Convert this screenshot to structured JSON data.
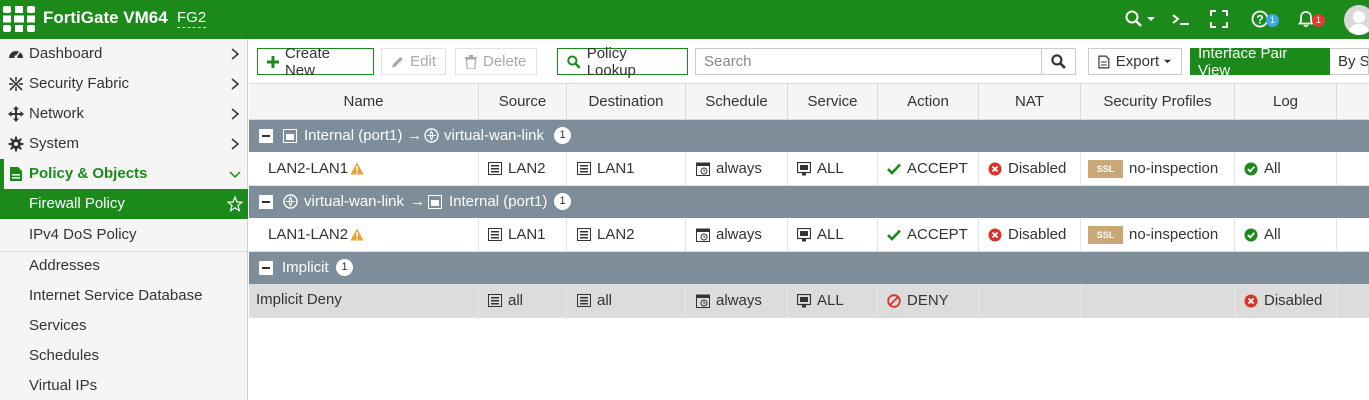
{
  "header": {
    "brand": "FortiGate VM64",
    "hostname": "FG2",
    "help_badge": "1",
    "alerts_badge": "1",
    "colors": {
      "brand": "#1b8a1b",
      "help_badge": "#3fa7e1",
      "alert_badge": "#e03c31"
    }
  },
  "sidebar": {
    "items": [
      {
        "label": "Dashboard",
        "icon": "dashboard-icon"
      },
      {
        "label": "Security Fabric",
        "icon": "security-fabric-icon"
      },
      {
        "label": "Network",
        "icon": "network-icon"
      },
      {
        "label": "System",
        "icon": "gear-icon"
      },
      {
        "label": "Policy & Objects",
        "icon": "policy-icon"
      }
    ],
    "sub_items": [
      {
        "label": "Firewall Policy"
      },
      {
        "label": "IPv4 DoS Policy"
      },
      {
        "label": "Addresses"
      },
      {
        "label": "Internet Service Database"
      },
      {
        "label": "Services"
      },
      {
        "label": "Schedules"
      },
      {
        "label": "Virtual IPs"
      }
    ]
  },
  "toolbar": {
    "create_label": "Create New",
    "edit_label": "Edit",
    "delete_label": "Delete",
    "lookup_label": "Policy Lookup",
    "search_placeholder": "Search",
    "export_label": "Export",
    "view_interface_pair": "Interface Pair View",
    "view_sequence": "By Se"
  },
  "table": {
    "columns": [
      "Name",
      "Source",
      "Destination",
      "Schedule",
      "Service",
      "Action",
      "NAT",
      "Security Profiles",
      "Log"
    ],
    "groups": [
      {
        "src": "Internal (port1)",
        "arrow": "→",
        "dst": "virtual-wan-link",
        "count": "1",
        "rows": [
          {
            "name": "LAN2-LAN1",
            "source": "LAN2",
            "destination": "LAN1",
            "schedule": "always",
            "service": "ALL",
            "action": "ACCEPT",
            "nat": "Disabled",
            "ssl_tag": "SSL",
            "profile": "no-inspection",
            "log": "All"
          }
        ]
      },
      {
        "src": "virtual-wan-link",
        "arrow": "→",
        "dst": "Internal (port1)",
        "count": "1",
        "rows": [
          {
            "name": "LAN1-LAN2",
            "source": "LAN1",
            "destination": "LAN2",
            "schedule": "always",
            "service": "ALL",
            "action": "ACCEPT",
            "nat": "Disabled",
            "ssl_tag": "SSL",
            "profile": "no-inspection",
            "log": "All"
          }
        ]
      },
      {
        "label": "Implicit",
        "count": "1",
        "rows": [
          {
            "name": "Implicit Deny",
            "source": "all",
            "destination": "all",
            "schedule": "always",
            "service": "ALL",
            "action": "DENY",
            "log": "Disabled"
          }
        ]
      }
    ]
  }
}
